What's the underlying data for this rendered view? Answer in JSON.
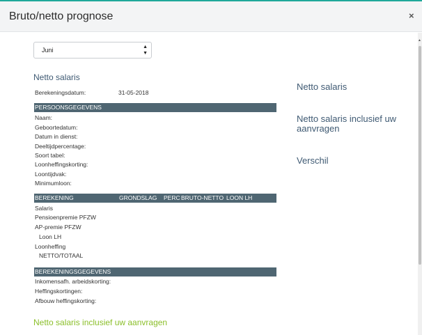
{
  "modal": {
    "title": "Bruto/netto prognose",
    "close": "×"
  },
  "month_select": {
    "selected": "Juni"
  },
  "netto": {
    "title": "Netto salaris",
    "calc_date_label": "Berekeningsdatum:",
    "calc_date_value": "31-05-2018"
  },
  "persoon": {
    "header": "PERSOONSGEGEVENS",
    "fields": [
      "Naam:",
      "Geboortedatum:",
      "Datum in dienst:",
      "Deeltijdpercentage:",
      "Soort tabel:",
      "Loonheffingskorting:",
      "Loontijdvak:",
      "Minimumloon:"
    ]
  },
  "berekening": {
    "headers": [
      "BEREKENING",
      "GRONDSLAG",
      "PERC",
      "BRUTO-NETTO",
      "LOON LH"
    ],
    "rows": [
      "Salaris",
      "Pensioenpremie PFZW",
      "AP-premie PFZW",
      "Loon LH",
      "Loonheffing",
      "NETTO/TOTAAL"
    ]
  },
  "berekeningsgegevens": {
    "header": "BEREKENINGSGEGEVENS",
    "fields": [
      "Inkomensafh. arbeidskorting:",
      "Heffingskortingen:",
      "Afbouw heffingskorting:"
    ]
  },
  "incl": {
    "title": "Netto salaris inclusief uw aanvragen"
  },
  "right": {
    "netto": "Netto salaris",
    "incl_line1": "Netto salaris inclusief uw",
    "incl_line2": "aanvragen",
    "verschil": "Verschil"
  },
  "colors": {
    "accent_teal": "#1fa89a",
    "bar": "#4f6672",
    "title_blue": "#3f5a73",
    "title_green": "#8bbf2a"
  }
}
